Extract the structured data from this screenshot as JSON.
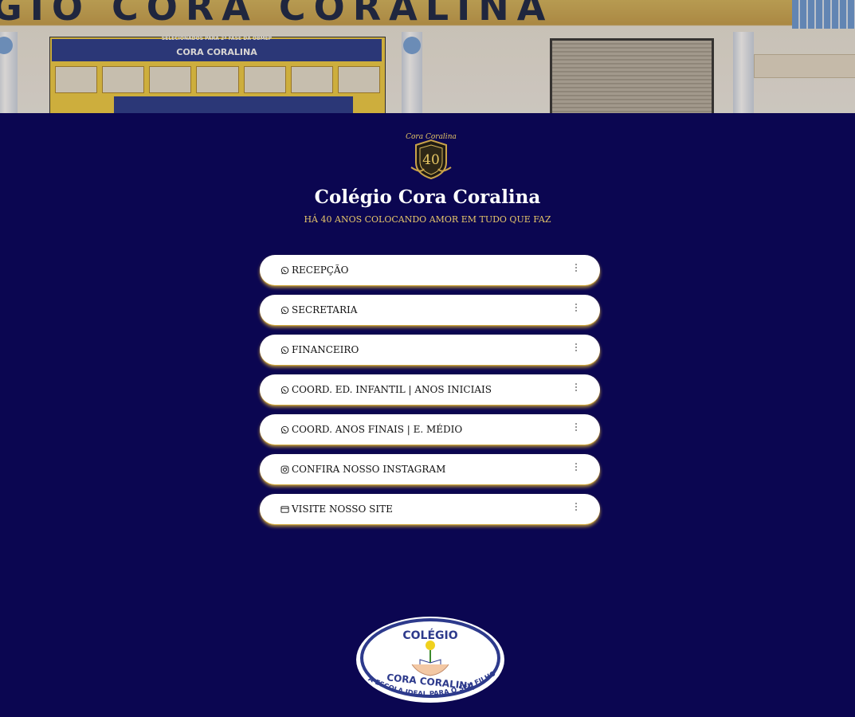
{
  "hero": {
    "facade_text": "GIO  CORA  CORALINA",
    "panel_header_small": "SELECIONADOS PARA 2ª FASE DA OBMEP",
    "panel_header": "CORA CORALINA"
  },
  "profile": {
    "badge_text": "Cora Coralina",
    "badge_number": "40",
    "title": "Colégio Cora Coralina",
    "subtitle": "HÁ 40 ANOS COLOCANDO AMOR EM TUDO QUE FAZ"
  },
  "links": [
    {
      "icon": "whatsapp-icon",
      "label": "RECEPÇÃO"
    },
    {
      "icon": "whatsapp-icon",
      "label": "SECRETARIA"
    },
    {
      "icon": "whatsapp-icon",
      "label": "FINANCEIRO"
    },
    {
      "icon": "whatsapp-icon",
      "label": "COORD. ED. INFANTIL | ANOS INICIAIS"
    },
    {
      "icon": "whatsapp-icon",
      "label": "COORD. ANOS FINAIS | E. MÉDIO"
    },
    {
      "icon": "instagram-icon",
      "label": "CONFIRA NOSSO INSTAGRAM"
    },
    {
      "icon": "browser-icon",
      "label": "VISITE NOSSO SITE"
    }
  ],
  "footer_logo": {
    "top": "COLÉGIO",
    "middle": "CORA CORALINA",
    "tagline": "A ESCOLA IDEAL PARA O SEU FILHO"
  },
  "colors": {
    "background": "#0b0651",
    "button": "#ffffff",
    "button_glow": "#d4aa3c",
    "subtitle": "#e7c66a",
    "title": "#ffffff"
  }
}
